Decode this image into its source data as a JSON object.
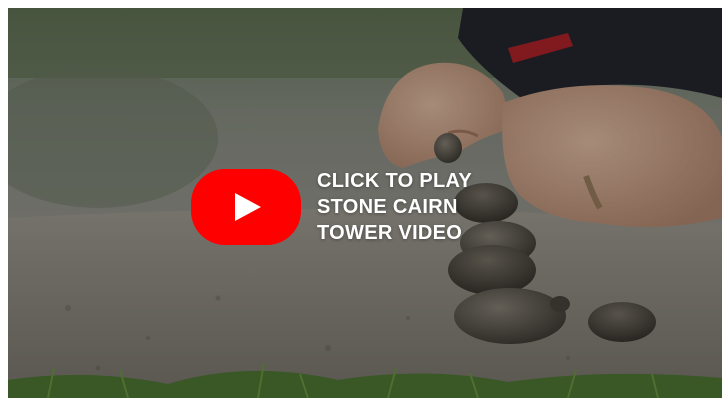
{
  "video": {
    "cta_label": "CLICK TO PLAY STONE CAIRN TOWER VIDEO",
    "play_icon": "youtube-play-icon",
    "brand_color": "#ff0000"
  }
}
